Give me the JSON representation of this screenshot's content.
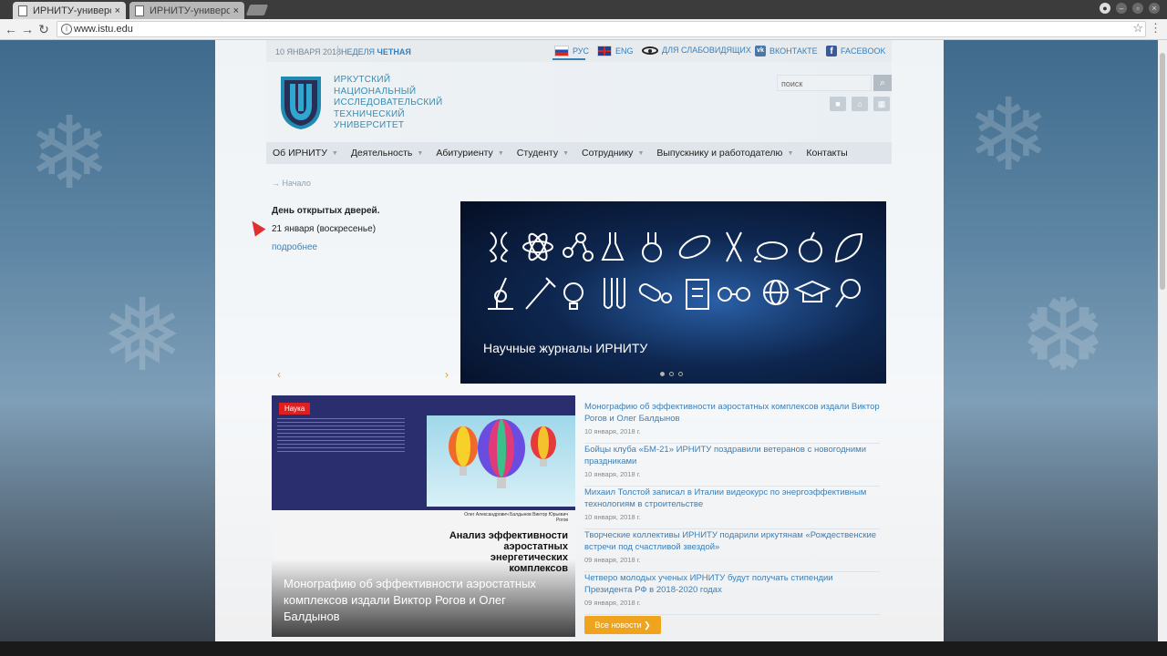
{
  "browser": {
    "tabs": [
      {
        "label": "ИРНИТУ-университ"
      },
      {
        "label": "ИРНИТУ-университ"
      }
    ],
    "close_glyph": "×",
    "url": "www.istu.edu"
  },
  "topbar": {
    "date": "10 ЯНВАРЯ 2018",
    "week_prefix": "НЕДЕЛЯ",
    "week_type": "ЧЕТНАЯ",
    "lang_ru": "РУС",
    "lang_en": "ENG",
    "low_vision": "ДЛЯ СЛАБОВИДЯЩИХ",
    "vk": "ВКОНТАКТЕ",
    "facebook": "FACEBOOK"
  },
  "header": {
    "uni_name_lines": [
      "ИРКУТСКИЙ",
      "НАЦИОНАЛЬНЫЙ",
      "ИССЛЕДОВАТЕЛЬСКИЙ",
      "ТЕХНИЧЕСКИЙ",
      "УНИВЕРСИТЕТ"
    ],
    "search_placeholder": "поиск"
  },
  "nav": [
    "Об ИРНИТУ",
    "Деятельность",
    "Абитуриенту",
    "Студенту",
    "Сотруднику",
    "Выпускнику и работодателю",
    "Контакты"
  ],
  "breadcrumb": "→ Начало",
  "event": {
    "title": "День открытых дверей.",
    "date": "21 января (воскресенье)",
    "more": "подробнее"
  },
  "banner": {
    "caption": "Научные журналы ИРНИТУ",
    "slides": 3,
    "active_slide": 1
  },
  "feature": {
    "tag": "Наука",
    "book_title": "Анализ эффективности аэростатных энергетических комплексов",
    "book_authors": "Олег Александрович Балдынов Виктор Юрьевич Рогов",
    "caption": "Монографию об эффективности аэростатных комплексов издали Виктор Рогов и Олег Балдынов"
  },
  "news": [
    {
      "title": "Монографию об эффективности аэростатных комплексов издали Виктор Рогов и Олег Балдынов",
      "date": "10 января, 2018 г."
    },
    {
      "title": "Бойцы клуба «БМ-21» ИРНИТУ поздравили ветеранов с новогодними праздниками",
      "date": "10 января, 2018 г."
    },
    {
      "title": "Михаил Толстой записал в Италии видеокурс по энергоэффективным технологиям в строительстве",
      "date": "10 января, 2018 г."
    },
    {
      "title": "Творческие коллективы ИРНИТУ подарили иркутянам «Рождественские встречи под счастливой звездой»",
      "date": "09 января, 2018 г."
    },
    {
      "title": "Четверо молодых ученых ИРНИТУ будут получать стипендии Президента РФ в 2018-2020 годах",
      "date": "09 января, 2018 г."
    }
  ],
  "all_news_label": "Все новости ❯"
}
